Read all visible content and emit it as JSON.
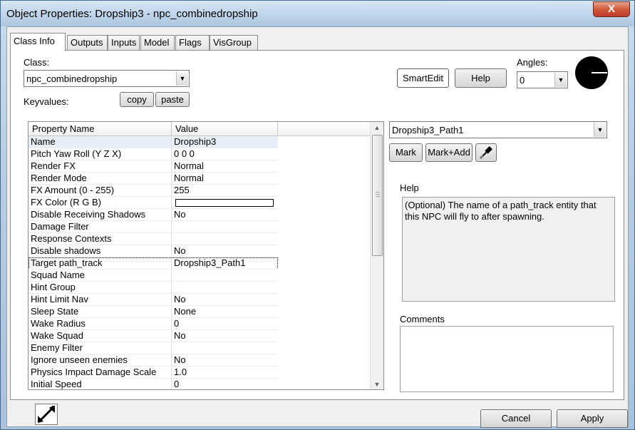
{
  "window": {
    "title": "Object Properties: Dropship3 - npc_combinedropship",
    "close_label": "X"
  },
  "tabs": [
    "Class Info",
    "Outputs",
    "Inputs",
    "Model",
    "Flags",
    "VisGroup"
  ],
  "class_section": {
    "label": "Class:",
    "value": "npc_combinedropship"
  },
  "keyvalues": {
    "label": "Keyvalues:",
    "copy_label": "copy",
    "paste_label": "paste"
  },
  "toolbar": {
    "smartedit_label": "SmartEdit",
    "help_label": "Help"
  },
  "angles": {
    "label": "Angles:",
    "value": "0"
  },
  "grid": {
    "headers": [
      "Property Name",
      "Value"
    ],
    "rows": [
      {
        "name": "Name",
        "value": "Dropship3"
      },
      {
        "name": "Pitch Yaw Roll (Y Z X)",
        "value": "0 0 0"
      },
      {
        "name": "Render FX",
        "value": "Normal"
      },
      {
        "name": "Render Mode",
        "value": "Normal"
      },
      {
        "name": "FX Amount (0 - 255)",
        "value": "255"
      },
      {
        "name": "FX Color (R G B)",
        "value": ""
      },
      {
        "name": "Disable Receiving Shadows",
        "value": "No"
      },
      {
        "name": "Damage Filter",
        "value": ""
      },
      {
        "name": "Response Contexts",
        "value": ""
      },
      {
        "name": "Disable shadows",
        "value": "No"
      },
      {
        "name": "Target path_track",
        "value": "Dropship3_Path1"
      },
      {
        "name": "Squad Name",
        "value": ""
      },
      {
        "name": "Hint Group",
        "value": ""
      },
      {
        "name": "Hint Limit Nav",
        "value": "No"
      },
      {
        "name": "Sleep State",
        "value": "None"
      },
      {
        "name": "Wake Radius",
        "value": "0"
      },
      {
        "name": "Wake Squad",
        "value": "No"
      },
      {
        "name": "Enemy Filter",
        "value": ""
      },
      {
        "name": "Ignore unseen enemies",
        "value": "No"
      },
      {
        "name": "Physics Impact Damage Scale",
        "value": "1.0"
      },
      {
        "name": "Initial Speed",
        "value": "0"
      }
    ]
  },
  "value_editor": {
    "value": "Dropship3_Path1",
    "mark_label": "Mark",
    "mark_add_label": "Mark+Add"
  },
  "help": {
    "label": "Help",
    "text": "(Optional) The name of a path_track entity that this NPC will fly to after spawning."
  },
  "comments": {
    "label": "Comments",
    "text": ""
  },
  "footer": {
    "cancel_label": "Cancel",
    "apply_label": "Apply"
  },
  "colors": {
    "title_bg": "#bcd3e9",
    "close_red": "#c0392b",
    "selected_row": "#e8eef8"
  }
}
